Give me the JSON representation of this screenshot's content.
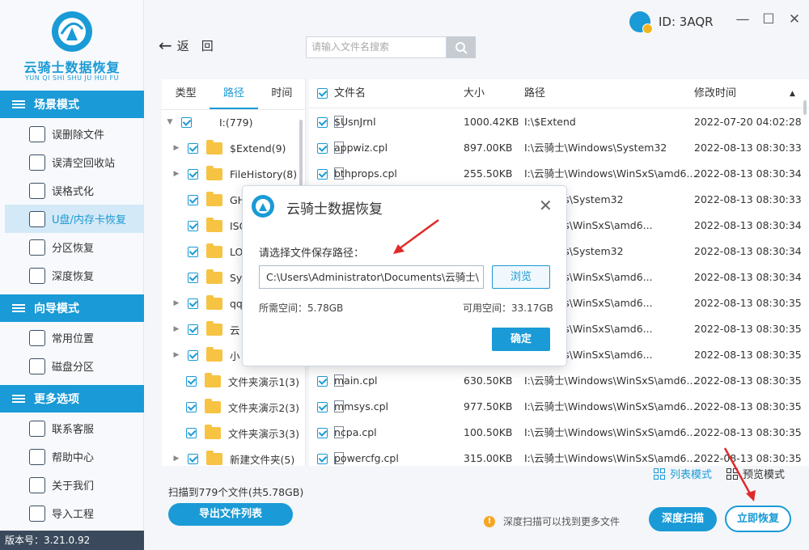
{
  "app": {
    "title": "云骑士数据恢复",
    "subtitle": "YUN QI SHI SHU JU HUI FU",
    "version": "版本号：3.21.0.92",
    "brand_color": "#1a9ad6"
  },
  "account": {
    "id": "ID: 3AQR"
  },
  "window_controls": [
    "—",
    "☐",
    "✕"
  ],
  "sidebar": {
    "sections": [
      {
        "title": "场景模式",
        "icon": "scene-icon",
        "items": [
          {
            "label": "误删除文件",
            "icon": "deleted-file-icon",
            "active": false
          },
          {
            "label": "误清空回收站",
            "icon": "recycle-bin-icon",
            "active": false
          },
          {
            "label": "误格式化",
            "icon": "format-icon",
            "active": false
          },
          {
            "label": "U盘/内存卡恢复",
            "icon": "usb-drive-icon",
            "active": true
          },
          {
            "label": "分区恢复",
            "icon": "partition-icon",
            "active": false
          },
          {
            "label": "深度恢复",
            "icon": "deep-recovery-icon",
            "active": false
          }
        ]
      },
      {
        "title": "向导模式",
        "icon": "guide-icon",
        "items": [
          {
            "label": "常用位置",
            "icon": "common-location-icon",
            "active": false
          },
          {
            "label": "磁盘分区",
            "icon": "disk-partition-icon",
            "active": false
          }
        ]
      },
      {
        "title": "更多选项",
        "icon": "menu-icon",
        "items": [
          {
            "label": "联系客服",
            "icon": "support-icon",
            "active": false
          },
          {
            "label": "帮助中心",
            "icon": "help-icon",
            "active": false
          },
          {
            "label": "关于我们",
            "icon": "about-icon",
            "active": false
          },
          {
            "label": "导入工程",
            "icon": "import-icon",
            "active": false
          }
        ]
      }
    ]
  },
  "toolbar": {
    "back_label": "返　回",
    "search_placeholder": "请输入文件名搜索"
  },
  "tree": {
    "tabs": [
      "类型",
      "路径",
      "时间"
    ],
    "active_tab": "路径",
    "rows": [
      {
        "label": "I:(779)",
        "expand": "▼",
        "folder": false
      },
      {
        "label": "$Extend(9)",
        "expand": "▶",
        "folder": true
      },
      {
        "label": "FileHistory(8)",
        "expand": "▶",
        "folder": true
      },
      {
        "label": "GHO",
        "expand": "",
        "folder": true
      },
      {
        "label": "ISO",
        "expand": "",
        "folder": true
      },
      {
        "label": "LOS",
        "expand": "",
        "folder": true
      },
      {
        "label": "Syst",
        "expand": "",
        "folder": true
      },
      {
        "label": "qq",
        "expand": "▶",
        "folder": true
      },
      {
        "label": "云",
        "expand": "▶",
        "folder": true
      },
      {
        "label": "小",
        "expand": "▶",
        "folder": true
      },
      {
        "label": "文件夹演示1(3)",
        "expand": "",
        "folder": true
      },
      {
        "label": "文件夹演示2(3)",
        "expand": "",
        "folder": true
      },
      {
        "label": "文件夹演示3(3)",
        "expand": "",
        "folder": true
      },
      {
        "label": "新建文件夹(5)",
        "expand": "▶",
        "folder": true
      }
    ]
  },
  "file_list": {
    "columns": {
      "name": "文件名",
      "size": "大小",
      "path": "路径",
      "modified": "修改时间",
      "sort_indicator": "▲"
    },
    "rows": [
      {
        "name": "$UsnJrnl",
        "size": "1000.42KB",
        "path": "I:\\$Extend",
        "modified": "2022-07-20 04:02:28"
      },
      {
        "name": "appwiz.cpl",
        "size": "897.00KB",
        "path": "I:\\云骑士\\Windows\\System32",
        "modified": "2022-08-13 08:30:33"
      },
      {
        "name": "bthprops.cpl",
        "size": "255.50KB",
        "path": "I:\\云骑士\\Windows\\WinSxS\\amd6...",
        "modified": "2022-08-13 08:30:34"
      },
      {
        "name": "",
        "size": "",
        "path": "Windows\\System32",
        "modified": "2022-08-13 08:30:33"
      },
      {
        "name": "",
        "size": "",
        "path": "Windows\\WinSxS\\amd6...",
        "modified": "2022-08-13 08:30:34"
      },
      {
        "name": "",
        "size": "",
        "path": "Windows\\System32",
        "modified": "2022-08-13 08:30:34"
      },
      {
        "name": "",
        "size": "",
        "path": "Windows\\WinSxS\\amd6...",
        "modified": "2022-08-13 08:30:34"
      },
      {
        "name": "",
        "size": "",
        "path": "Windows\\WinSxS\\amd6...",
        "modified": "2022-08-13 08:30:35"
      },
      {
        "name": "",
        "size": "",
        "path": "Windows\\WinSxS\\amd6...",
        "modified": "2022-08-13 08:30:35"
      },
      {
        "name": "",
        "size": "",
        "path": "Windows\\WinSxS\\amd6...",
        "modified": "2022-08-13 08:30:35"
      },
      {
        "name": "main.cpl",
        "size": "630.50KB",
        "path": "I:\\云骑士\\Windows\\WinSxS\\amd6...",
        "modified": "2022-08-13 08:30:35"
      },
      {
        "name": "mmsys.cpl",
        "size": "977.50KB",
        "path": "I:\\云骑士\\Windows\\WinSxS\\amd6...",
        "modified": "2022-08-13 08:30:35"
      },
      {
        "name": "ncpa.cpl",
        "size": "100.50KB",
        "path": "I:\\云骑士\\Windows\\WinSxS\\amd6...",
        "modified": "2022-08-13 08:30:35"
      },
      {
        "name": "powercfg.cpl",
        "size": "315.00KB",
        "path": "I:\\云骑士\\Windows\\WinSxS\\amd6...",
        "modified": "2022-08-13 08:30:35"
      }
    ]
  },
  "view_modes": {
    "list": "列表模式",
    "preview": "预览模式",
    "active": "list"
  },
  "footer": {
    "scan_info": "扫描到779个文件(共5.78GB)",
    "export_label": "导出文件列表",
    "tip": "深度扫描可以找到更多文件",
    "deep_scan_label": "深度扫描",
    "recover_label": "立即恢复"
  },
  "dialog": {
    "title": "云骑士数据恢复",
    "close": "✕",
    "prompt": "请选择文件保存路径：",
    "path_value": "C:\\Users\\Administrator\\Documents\\云骑士\\",
    "browse_label": "浏览",
    "required_space": "所需空间：5.78GB",
    "available_space": "可用空间：33.17GB",
    "confirm_label": "确定"
  },
  "annotation_color": "#e02a2a"
}
